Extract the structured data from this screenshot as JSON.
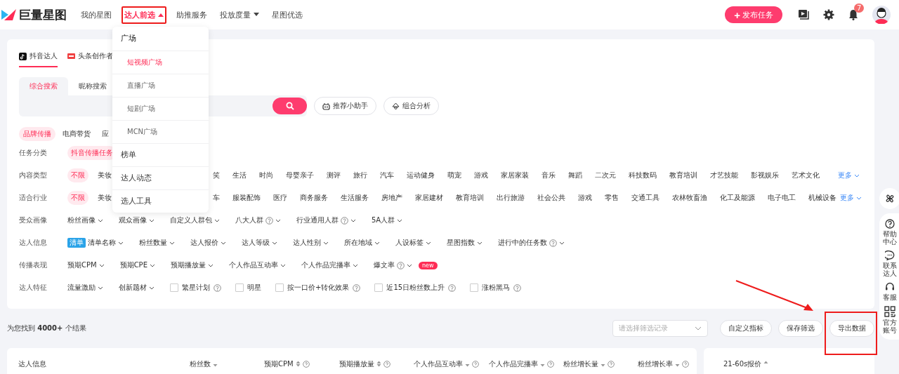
{
  "nav": {
    "logo": "巨量星图",
    "items": [
      {
        "label": "我的星图",
        "selected": false,
        "has_menu": false
      },
      {
        "label": "达人前选",
        "selected": true,
        "has_menu": true,
        "expanded": true
      },
      {
        "label": "助推服务",
        "selected": false,
        "has_menu": false
      },
      {
        "label": "投放度量",
        "selected": false,
        "has_menu": true,
        "expanded": false
      },
      {
        "label": "星图优选",
        "selected": false,
        "has_menu": false
      }
    ],
    "publish_button": {
      "icon": "+",
      "label": "发布任务"
    },
    "notification_count": "7"
  },
  "menu": [
    {
      "label": "广场",
      "kind": "group",
      "selected": false,
      "children": [
        {
          "label": "短视频广场",
          "selected": true
        },
        {
          "label": "直播广场",
          "selected": false
        },
        {
          "label": "短剧广场",
          "selected": false
        },
        {
          "label": "MCN广场",
          "selected": false
        }
      ]
    },
    {
      "label": "榜单",
      "kind": "item",
      "selected": false
    },
    {
      "label": "达人动态",
      "kind": "item",
      "selected": false
    },
    {
      "label": "选人工具",
      "kind": "item",
      "selected": false
    }
  ],
  "platform_tabs": [
    {
      "label": "抖音达人",
      "selected": true
    },
    {
      "label": "头条创作者",
      "selected": false
    }
  ],
  "search_tabs": [
    {
      "label": "综合搜索",
      "selected": true
    },
    {
      "label": "昵称搜索",
      "selected": false
    }
  ],
  "search_tools": [
    "推荐小助手",
    "组合分析"
  ],
  "channels": [
    {
      "label": "品牌传播",
      "selected": true
    },
    {
      "label": "电商带货",
      "selected": false
    },
    {
      "label": "应",
      "selected": false
    }
  ],
  "filters": [
    {
      "label": "任务分类",
      "options": [
        {
          "label": "抖音传播任务",
          "kind": "pill",
          "selected": true
        }
      ]
    },
    {
      "label": "内容类型",
      "more": "更多",
      "options": [
        {
          "label": "不限",
          "kind": "pill",
          "selected": true
        },
        {
          "label": "美妆",
          "kind": "pill",
          "selected": false
        },
        {
          "label": "笑",
          "kind": "pill",
          "selected": false
        },
        {
          "label": "生活",
          "kind": "pill",
          "selected": false
        },
        {
          "label": "时尚",
          "kind": "pill",
          "selected": false
        },
        {
          "label": "母婴亲子",
          "kind": "pill",
          "selected": false
        },
        {
          "label": "测评",
          "kind": "pill",
          "selected": false
        },
        {
          "label": "旅行",
          "kind": "pill",
          "selected": false
        },
        {
          "label": "汽车",
          "kind": "pill",
          "selected": false
        },
        {
          "label": "运动健身",
          "kind": "pill",
          "selected": false
        },
        {
          "label": "萌宠",
          "kind": "pill",
          "selected": false
        },
        {
          "label": "游戏",
          "kind": "pill",
          "selected": false
        },
        {
          "label": "家居家装",
          "kind": "pill",
          "selected": false
        },
        {
          "label": "音乐",
          "kind": "pill",
          "selected": false
        },
        {
          "label": "舞蹈",
          "kind": "pill",
          "selected": false
        },
        {
          "label": "二次元",
          "kind": "pill",
          "selected": false
        },
        {
          "label": "科技数码",
          "kind": "pill",
          "selected": false
        },
        {
          "label": "教育培训",
          "kind": "pill",
          "selected": false
        },
        {
          "label": "才艺技能",
          "kind": "pill",
          "selected": false
        },
        {
          "label": "影视娱乐",
          "kind": "pill",
          "selected": false
        },
        {
          "label": "艺术文化",
          "kind": "pill",
          "selected": false
        }
      ]
    },
    {
      "label": "适合行业",
      "more": "更多",
      "options": [
        {
          "label": "不限",
          "kind": "pill",
          "selected": true
        },
        {
          "label": "美妆",
          "kind": "pill",
          "selected": false
        },
        {
          "label": "车",
          "kind": "pill",
          "selected": false
        },
        {
          "label": "服装配饰",
          "kind": "pill",
          "selected": false
        },
        {
          "label": "医疗",
          "kind": "pill",
          "selected": false
        },
        {
          "label": "商务服务",
          "kind": "pill",
          "selected": false
        },
        {
          "label": "生活服务",
          "kind": "pill",
          "selected": false
        },
        {
          "label": "房地产",
          "kind": "pill",
          "selected": false
        },
        {
          "label": "家居建材",
          "kind": "pill",
          "selected": false
        },
        {
          "label": "教育培训",
          "kind": "pill",
          "selected": false
        },
        {
          "label": "出行旅游",
          "kind": "pill",
          "selected": false
        },
        {
          "label": "社会公共",
          "kind": "pill",
          "selected": false
        },
        {
          "label": "游戏",
          "kind": "pill",
          "selected": false
        },
        {
          "label": "零售",
          "kind": "pill",
          "selected": false
        },
        {
          "label": "交通工具",
          "kind": "pill",
          "selected": false
        },
        {
          "label": "农林牧畜渔",
          "kind": "pill",
          "selected": false
        },
        {
          "label": "化工及能源",
          "kind": "pill",
          "selected": false
        },
        {
          "label": "电子电工",
          "kind": "pill",
          "selected": false
        },
        {
          "label": "机械设备",
          "kind": "pill",
          "selected": false
        }
      ]
    },
    {
      "label": "受众画像",
      "options": [
        {
          "label": "粉丝画像",
          "kind": "dropdown",
          "help": false
        },
        {
          "label": "观众画像",
          "kind": "dropdown",
          "help": false
        },
        {
          "label": "自定义人群包",
          "kind": "dropdown",
          "help": false
        },
        {
          "label": "八大人群",
          "kind": "dropdown",
          "help": true
        },
        {
          "label": "行业通用人群",
          "kind": "dropdown",
          "help": true
        },
        {
          "label": "5A人群",
          "kind": "dropdown",
          "help": false
        }
      ]
    },
    {
      "label": "达人信息",
      "options": [
        {
          "label": "清单名称",
          "kind": "dropdown",
          "help": false,
          "badge": "清单"
        },
        {
          "label": "粉丝数量",
          "kind": "dropdown",
          "help": false
        },
        {
          "label": "达人报价",
          "kind": "dropdown",
          "help": false
        },
        {
          "label": "达人等级",
          "kind": "dropdown",
          "help": false
        },
        {
          "label": "达人性别",
          "kind": "dropdown",
          "help": false
        },
        {
          "label": "所在地域",
          "kind": "dropdown",
          "help": false
        },
        {
          "label": "人设标签",
          "kind": "dropdown",
          "help": false
        },
        {
          "label": "星图指数",
          "kind": "dropdown",
          "help": false
        },
        {
          "label": "进行中的任务数",
          "kind": "dropdown",
          "help": true
        }
      ]
    },
    {
      "label": "传播表现",
      "options": [
        {
          "label": "预期CPM",
          "kind": "dropdown",
          "help": false
        },
        {
          "label": "预期CPE",
          "kind": "dropdown",
          "help": false
        },
        {
          "label": "预期播放量",
          "kind": "dropdown",
          "help": false
        },
        {
          "label": "个人作品互动率",
          "kind": "dropdown",
          "help": false
        },
        {
          "label": "个人作品完播率",
          "kind": "dropdown",
          "help": false
        },
        {
          "label": "爆文率",
          "kind": "dropdown",
          "help": true,
          "tag": "new"
        }
      ]
    },
    {
      "label": "达人特征",
      "options": [
        {
          "label": "流量激励",
          "kind": "dropdown",
          "help": false
        },
        {
          "label": "创新题材",
          "kind": "dropdown",
          "help": false
        },
        {
          "label": "繁星计划",
          "kind": "checkbox",
          "checked": false,
          "help": true
        },
        {
          "label": "明星",
          "kind": "checkbox",
          "checked": false,
          "help": false
        },
        {
          "label": "按一口价+转化效果",
          "kind": "checkbox",
          "checked": false,
          "help": true
        },
        {
          "label": "近15日粉丝数上升",
          "kind": "checkbox",
          "checked": false,
          "help": true
        },
        {
          "label": "涨粉黑马",
          "kind": "checkbox",
          "checked": false,
          "help": true
        }
      ]
    }
  ],
  "results": {
    "summary": "为您找到 **4000+** 个结果",
    "record_select": {
      "placeholder": "请选择筛选记录"
    },
    "buttons": [
      "自定义指标",
      "保存筛选",
      "导出数据"
    ]
  },
  "table": {
    "columns": [
      {
        "label": "达人信息",
        "sort_up": false,
        "sort_down": false,
        "help": false
      },
      {
        "label": "粉丝数",
        "sort_up": false,
        "sort_down": true,
        "help": false
      },
      {
        "label": "预期CPM",
        "sort_up": true,
        "sort_down": true,
        "help": true
      },
      {
        "label": "预期播放量",
        "sort_up": true,
        "sort_down": true,
        "help": true
      },
      {
        "label": "个人作品互动率",
        "sort_up": false,
        "sort_down": true,
        "help": true
      },
      {
        "label": "个人作品完播率",
        "sort_up": false,
        "sort_down": true,
        "help": true
      },
      {
        "label": "粉丝增长量",
        "sort_up": false,
        "sort_down": true,
        "help": true
      },
      {
        "label": "粉丝增长率",
        "sort_up": false,
        "sort_down": true,
        "help": true
      }
    ],
    "side_column": {
      "label": "21-60s报价",
      "sort_up": true,
      "sort_down": false
    }
  },
  "side_tools": [
    {
      "kind": "pinwheel"
    },
    {
      "kind": "help",
      "label": "帮助中心"
    },
    {
      "kind": "chat",
      "label": "联系达人"
    },
    {
      "kind": "headset",
      "label": "客服"
    },
    {
      "kind": "grid",
      "label": "官方账号"
    }
  ]
}
